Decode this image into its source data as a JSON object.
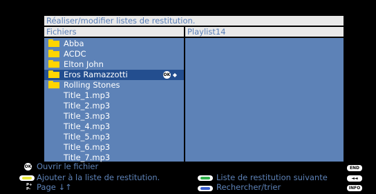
{
  "title": "Réaliser/modifier listes de restitution.",
  "left_header": "Fichiers",
  "right_header": "Playlist14",
  "files": [
    {
      "name": "Abba",
      "type": "folder"
    },
    {
      "name": "ACDC",
      "type": "folder"
    },
    {
      "name": "Elton John",
      "type": "folder"
    },
    {
      "name": "Eros Ramazzotti",
      "type": "folder",
      "selected": true
    },
    {
      "name": "Rolling Stones",
      "type": "folder"
    },
    {
      "name": "Title_1.mp3",
      "type": "file"
    },
    {
      "name": "Title_2.mp3",
      "type": "file"
    },
    {
      "name": "Title_3.mp3",
      "type": "file"
    },
    {
      "name": "Title_4.mp3",
      "type": "file"
    },
    {
      "name": "Title_5.mp3",
      "type": "file"
    },
    {
      "name": "Title_6.mp3",
      "type": "file"
    },
    {
      "name": "Title_7.mp3",
      "type": "file"
    }
  ],
  "selected_row_icons": {
    "ok_label": "OK",
    "arrows": "◆"
  },
  "footer": {
    "ok_label": "OK",
    "open_file": "Ouvrir le fichier",
    "add_to_list": "Ajouter à la liste de restitution.",
    "page_key": "P+\nP-",
    "page": "Page ↓↑",
    "next_list": "Liste de restitution suivante",
    "search_sort": "Rechercher/trier",
    "end_key": "END",
    "rewind_key": "◄◄",
    "info_key": "INFO"
  },
  "colors": {
    "background": "#000000",
    "pane": "#5d82b7",
    "selection": "#234e8f",
    "header_bg": "#e9e9e9",
    "folder": "#ffd500",
    "yellow_key": "#e8e83a",
    "green_key": "#2fb04a",
    "blue_key": "#3a5ccf"
  }
}
